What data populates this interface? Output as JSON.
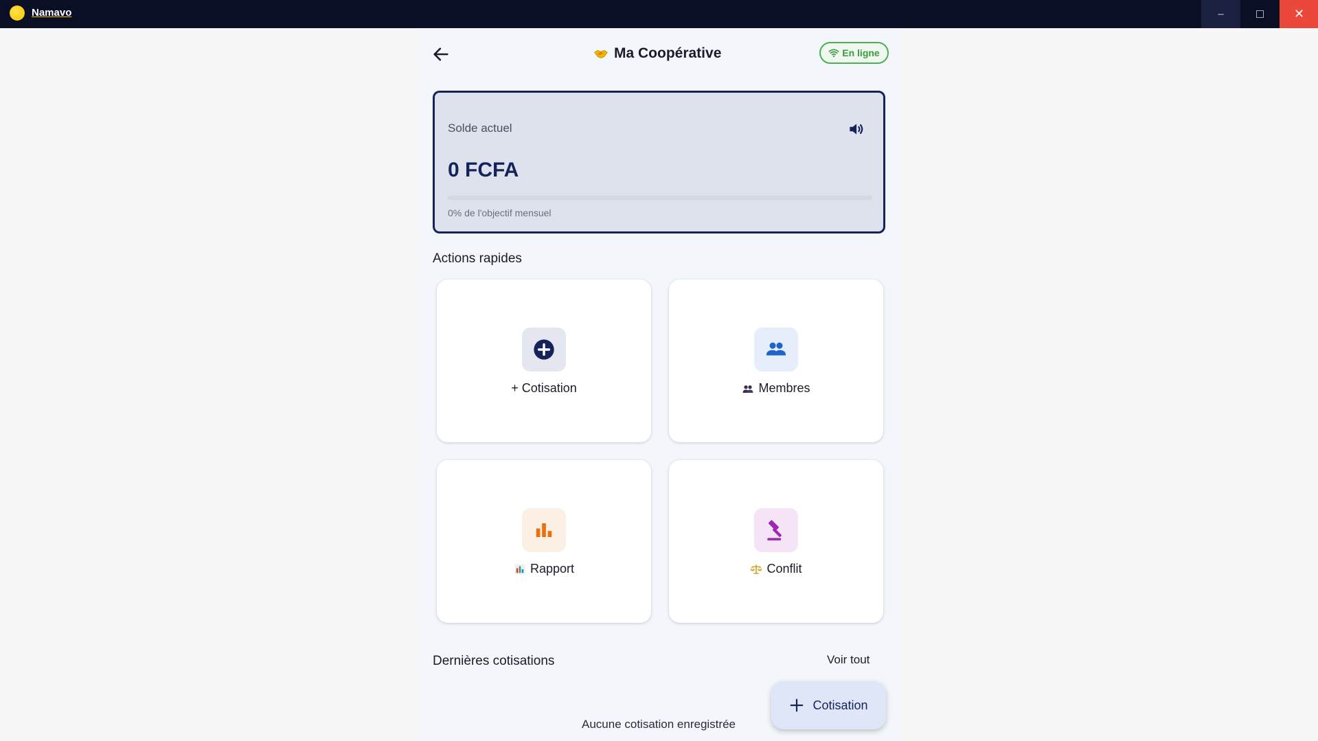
{
  "window": {
    "app_title": "Namavo",
    "controls": {
      "minimize": "–",
      "maximize": "☐",
      "close": "✕"
    }
  },
  "header": {
    "title": "Ma Coopérative",
    "status": "En ligne"
  },
  "balance": {
    "label": "Solde actuel",
    "value": "0 FCFA",
    "goal_text": "0% de l'objectif mensuel",
    "progress_fraction": 0
  },
  "quick_actions": {
    "title": "Actions rapides",
    "items": [
      {
        "label": "+ Cotisation",
        "icon": "plus-circle-icon"
      },
      {
        "label": "Membres",
        "icon": "people-icon"
      },
      {
        "label": "Rapport",
        "icon": "bar-chart-icon"
      },
      {
        "label": "Conflit",
        "icon": "gavel-icon"
      }
    ]
  },
  "recent": {
    "title": "Dernières cotisations",
    "see_all": "Voir tout",
    "empty_text": "Aucune cotisation enregistrée"
  },
  "fab": {
    "label": "Cotisation"
  },
  "colors": {
    "titlebar": "#0a0f26",
    "accent_navy": "#15235a",
    "online_green": "#4caf50",
    "members_blue": "#1f65c8",
    "report_orange": "#e8700f",
    "conflict_purple": "#9c27b0",
    "close_red": "#e9483a"
  }
}
